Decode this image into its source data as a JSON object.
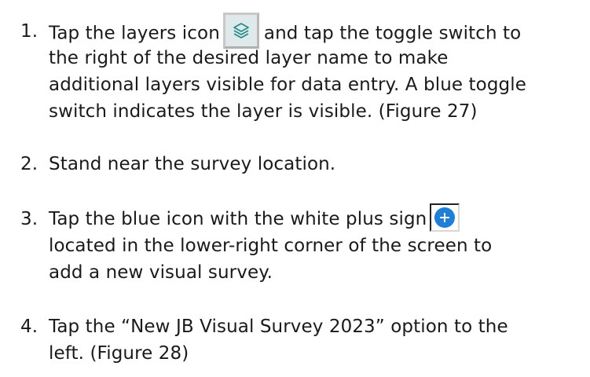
{
  "steps": [
    {
      "number": "1.",
      "line1_before": "Tap the layers icon",
      "icon": "layers-icon",
      "line1_after": "and tap the toggle switch to",
      "line2": "the right of the desired layer name to make",
      "line3": "additional layers visible for data entry. A blue toggle",
      "line4": "switch indicates the layer is visible. (Figure 27)"
    },
    {
      "number": "2.",
      "line1": "Stand near the survey location."
    },
    {
      "number": "3.",
      "line1_before": "Tap the blue icon with the white plus sign",
      "icon": "plus-circle-icon",
      "line2": "located in the lower-right corner of the screen to",
      "line3": "add a new visual survey."
    },
    {
      "number": "4.",
      "line1": "Tap the “New JB Visual Survey 2023” option to the",
      "line2": "left. (Figure 28)"
    }
  ],
  "colors": {
    "text": "#1a1a1a",
    "plus_icon_blue": "#1e7fd8",
    "layers_icon_bg": "#dfe9ea"
  }
}
